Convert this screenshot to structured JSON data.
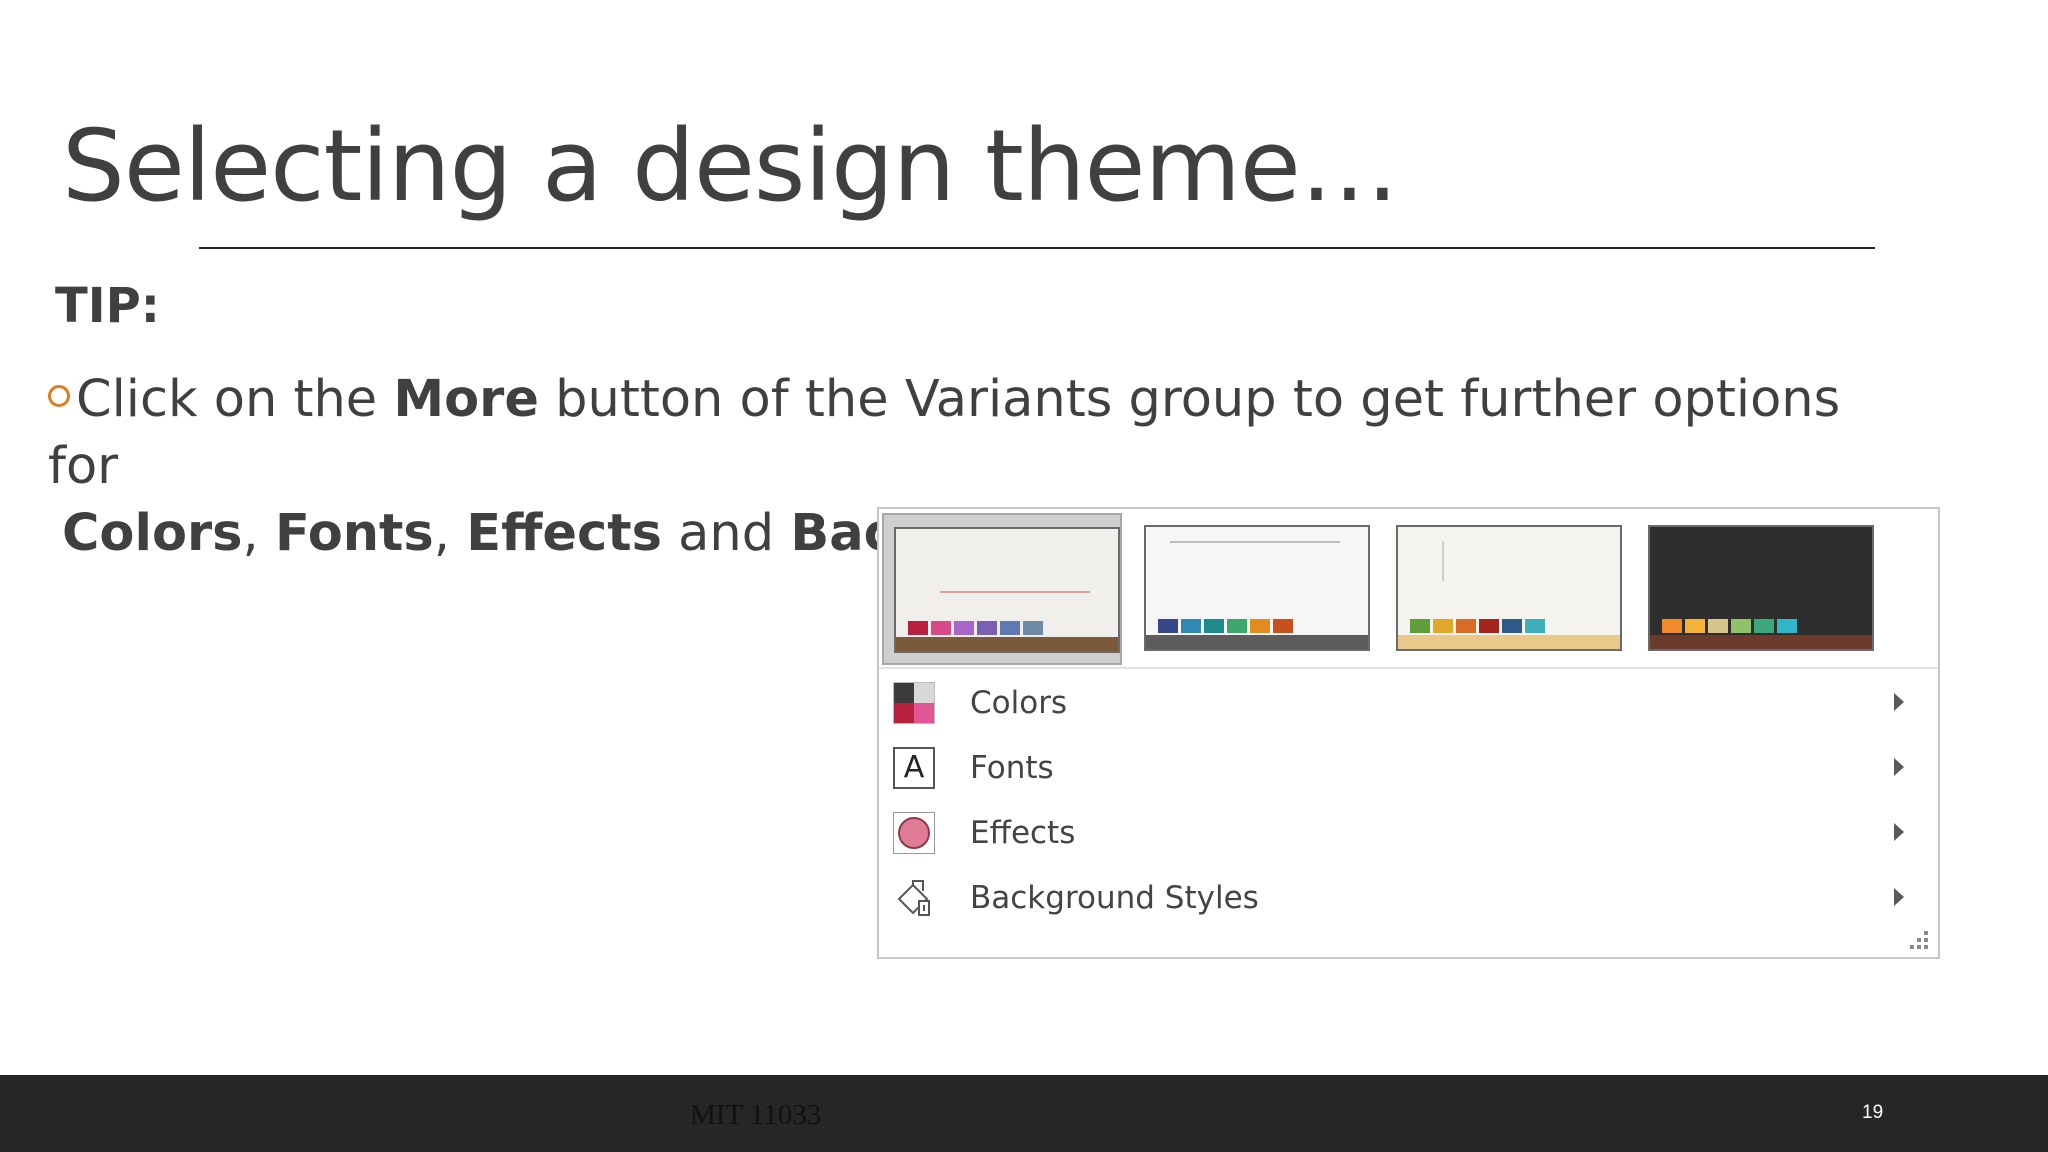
{
  "slide": {
    "title": "Selecting a design theme…",
    "tip_label": "TIP:",
    "bullet": {
      "t1": "Click on the ",
      "b1": "More",
      "t2": " button of the Variants group to get further options for",
      "b2": "Colors",
      "t3": ", ",
      "b3": "Fonts",
      "t4": ", ",
      "b4": "Effects",
      "t5": " and ",
      "b5": "Background Styles"
    }
  },
  "variants_menu": {
    "thumbnails": [
      {
        "name": "variant-1",
        "selected": true,
        "background": "#f1efec",
        "floor": "#7a5a3a",
        "swatches": [
          "#b8213e",
          "#d84a86",
          "#a964c8",
          "#7b5fb0",
          "#5f79b5",
          "#6e8aa6"
        ]
      },
      {
        "name": "variant-2",
        "selected": false,
        "background": "#f6f6f7",
        "floor": "#5c5c5c",
        "swatches": [
          "#37478a",
          "#2f8ab3",
          "#1f8a8a",
          "#3aa86a",
          "#e38c1e",
          "#c8501d"
        ]
      },
      {
        "name": "variant-3",
        "selected": false,
        "background": "#f4f3ee",
        "floor": "#e8c98a",
        "swatches": [
          "#5f9c3a",
          "#e0a827",
          "#d86c27",
          "#a5231f",
          "#2a5b8a",
          "#3cb0b8"
        ]
      },
      {
        "name": "variant-4",
        "selected": false,
        "background": "#2e2e2e",
        "floor": "#6b3a2a",
        "swatches": [
          "#f08a2a",
          "#f4b23a",
          "#d6c48a",
          "#8fc26a",
          "#3aa87a",
          "#2fb6c8"
        ]
      }
    ],
    "items": [
      {
        "label": "Colors",
        "icon": "colors-icon"
      },
      {
        "label": "Fonts",
        "icon": "fonts-icon"
      },
      {
        "label": "Effects",
        "icon": "effects-icon"
      },
      {
        "label": "Background Styles",
        "icon": "background-styles-icon"
      }
    ],
    "fonts_icon_glyph": "A"
  },
  "footer": {
    "course": "MIT 11033",
    "page_number": "19"
  }
}
